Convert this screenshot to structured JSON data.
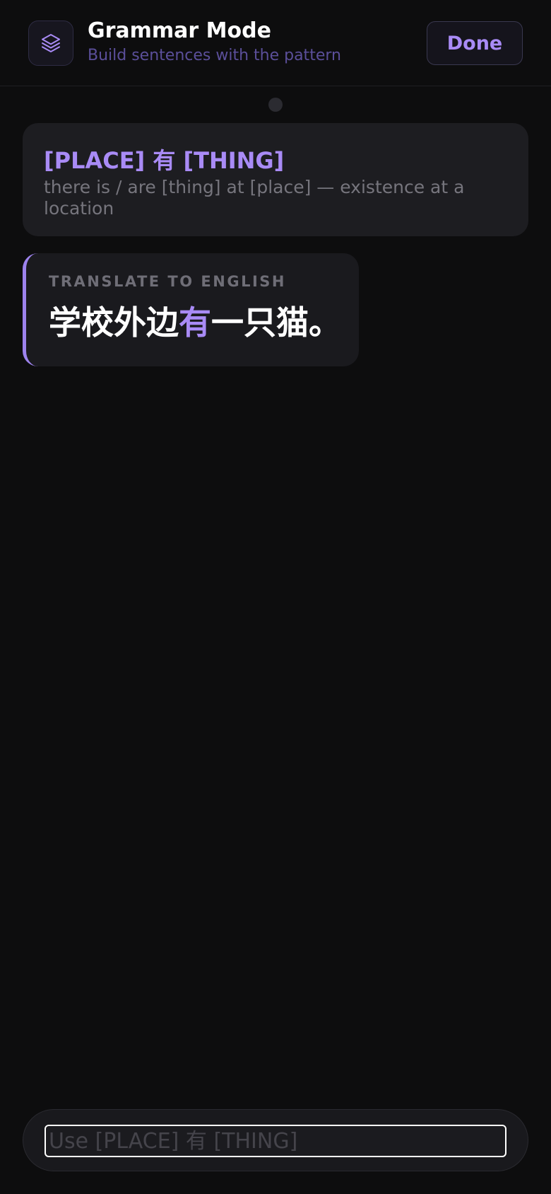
{
  "header": {
    "title": "Grammar Mode",
    "subtitle": "Build sentences with the pattern",
    "icon": "layers-icon",
    "done_label": "Done"
  },
  "pattern": {
    "title": "[PLACE] 有 [THING]",
    "description": "there is / are [thing] at [place] — existence at a location"
  },
  "prompt": {
    "label": "TRANSLATE TO ENGLISH",
    "sentence_before": "学校外边",
    "sentence_highlight": "有",
    "sentence_after": "一只猫。"
  },
  "input": {
    "placeholder": "Use [PLACE] 有 [THING]",
    "value": ""
  },
  "colors": {
    "background": "#0d0d0e",
    "accent": "#a98bf6",
    "subtitle": "#5b4f9a",
    "card": "#1d1d21"
  }
}
